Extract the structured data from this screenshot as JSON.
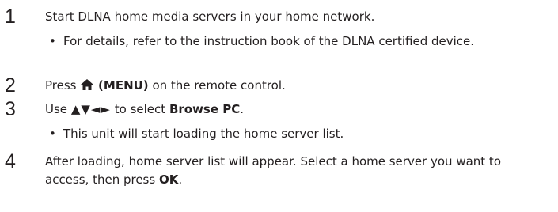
{
  "steps": [
    {
      "number": "1",
      "text": "Start DLNA home media servers in your home network.",
      "bullets": [
        "For details, refer to the instruction book of the DLNA certified device."
      ]
    },
    {
      "number": "2",
      "text_before": "Press",
      "icon": "home-icon",
      "bold": "(MENU)",
      "text_after": "on the remote control."
    },
    {
      "number": "3",
      "text_before": "Use",
      "arrows": "▲▼◄►",
      "text_mid": "to select",
      "bold": "Browse PC",
      "text_after": ".",
      "bullets": [
        "This unit will start loading the home server list."
      ]
    },
    {
      "number": "4",
      "text": "After loading, home server list will appear. Select a home server you want to access, then press",
      "bold": "OK",
      "text_after": "."
    }
  ],
  "bullet_symbol": "•"
}
